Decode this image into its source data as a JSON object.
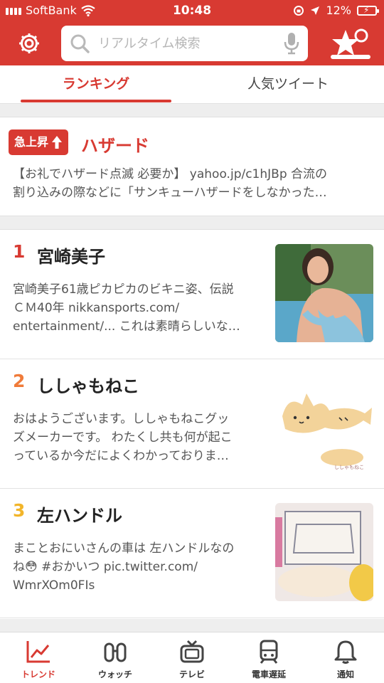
{
  "status_bar": {
    "carrier": "SoftBank",
    "time": "10:48",
    "battery": "12%"
  },
  "header": {
    "search_placeholder": "リアルタイム検索"
  },
  "tabs": [
    {
      "label": "ランキング",
      "active": true
    },
    {
      "label": "人気ツイート",
      "active": false
    }
  ],
  "surge": {
    "badge": "急上昇",
    "title": "ハザード",
    "text_line1": "【お礼でハザード点滅 必要か】 yahoo.jp/c1hJBp 合流の",
    "text_line2": "割り込みの際などに「サンキューハザードをしなかった…"
  },
  "ranking": [
    {
      "rank": "1",
      "rank_color": "#d83a32",
      "title": "宮崎美子",
      "lines": [
        "宮崎美子61歳ピカピカのビキニ姿、伝説",
        "ＣＭ40年 nikkansports.com/",
        "entertainment/... これは素晴らしいな…"
      ]
    },
    {
      "rank": "2",
      "rank_color": "#f07b3a",
      "title": "ししゃもねこ",
      "lines": [
        "おはようございます。ししゃもねこグッ",
        "ズメーカーです。 わたくし共も何が起こ",
        "っているか今だによくわかっておりま…"
      ]
    },
    {
      "rank": "3",
      "rank_color": "#f2b52a",
      "title": "左ハンドル",
      "lines": [
        "まことおにいさんの車は 左ハンドルなの",
        "ね😳 #おかいつ pic.twitter.com/",
        "WmrXOm0FIs"
      ]
    }
  ],
  "thumb2_caption": "ししゃもねこ",
  "bottom_nav": [
    {
      "label": "トレンド",
      "active": true
    },
    {
      "label": "ウォッチ",
      "active": false
    },
    {
      "label": "テレビ",
      "active": false
    },
    {
      "label": "電車遅延",
      "active": false
    },
    {
      "label": "通知",
      "active": false
    }
  ],
  "colors": {
    "brand_red": "#d83a32",
    "background": "#eeeeee"
  }
}
